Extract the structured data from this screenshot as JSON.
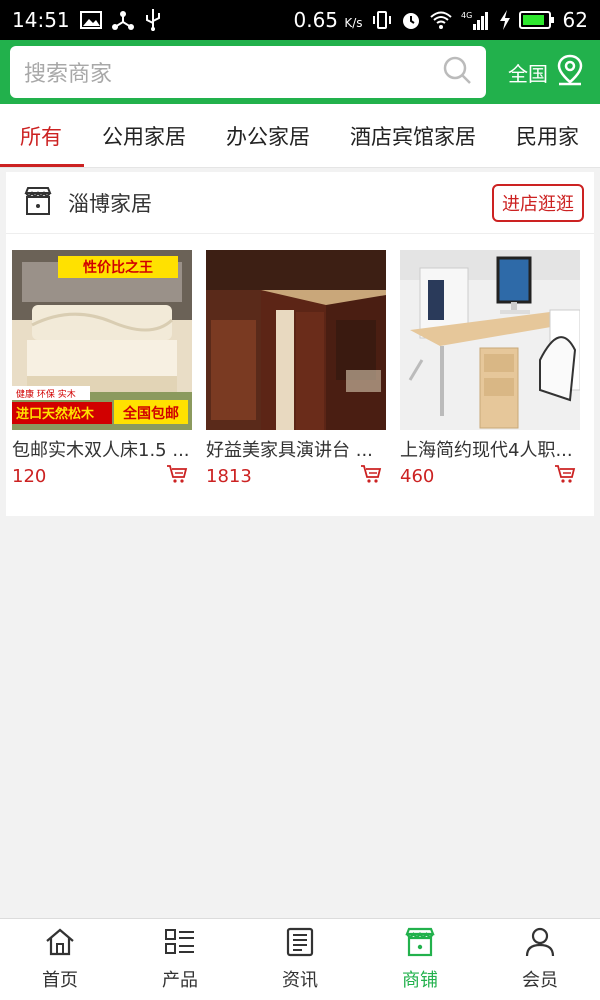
{
  "status_bar": {
    "time": "14:51",
    "net_speed": "0.65",
    "net_unit": "K/s",
    "signal": "4G",
    "battery": "62"
  },
  "header": {
    "search_placeholder": "搜索商家",
    "region_label": "全国"
  },
  "tabs": [
    {
      "label": "所有",
      "active": true
    },
    {
      "label": "公用家居",
      "active": false
    },
    {
      "label": "办公家居",
      "active": false
    },
    {
      "label": "酒店宾馆家居",
      "active": false
    },
    {
      "label": "民用家",
      "active": false
    }
  ],
  "shop": {
    "name": "淄博家居",
    "visit_label": "进店逛逛",
    "products": [
      {
        "name": "包邮实木双人床1.5 ...",
        "price": "120",
        "image_text": {
          "banner": "性价比之王",
          "tag": "健康 环保 实木",
          "slogan": "进口天然松木",
          "promo": "全国包邮"
        }
      },
      {
        "name": "好益美家具演讲台 ...",
        "price": "1813"
      },
      {
        "name": "上海简约现代4人职...",
        "price": "460"
      }
    ]
  },
  "bottom_nav": [
    {
      "label": "首页",
      "icon": "home-icon"
    },
    {
      "label": "产品",
      "icon": "list-icon"
    },
    {
      "label": "资讯",
      "icon": "news-icon"
    },
    {
      "label": "商铺",
      "icon": "shop-icon",
      "active": true
    },
    {
      "label": "会员",
      "icon": "user-icon"
    }
  ],
  "colors": {
    "brand_green": "#22b14c",
    "accent_red": "#cc2222"
  }
}
